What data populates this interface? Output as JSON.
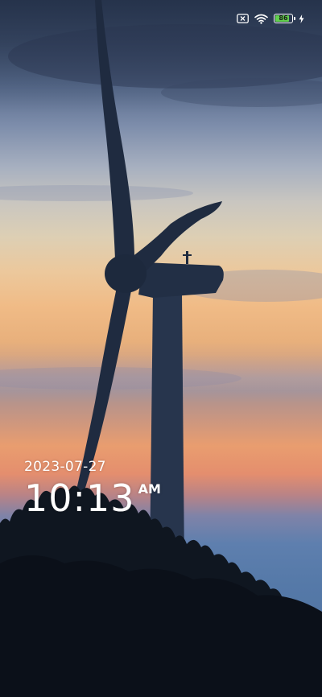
{
  "status_bar": {
    "sim_icon": "no-sim-icon",
    "wifi_icon": "wifi-icon",
    "battery_level": "86",
    "battery_fraction": 0.86,
    "battery_color": "#62d14d",
    "charging_icon": "charging-bolt-icon"
  },
  "lock_screen": {
    "date": "2023-07-27",
    "time": "10:13",
    "ampm": "AM"
  },
  "wallpaper": {
    "subject": "wind-turbine-at-sunset"
  }
}
